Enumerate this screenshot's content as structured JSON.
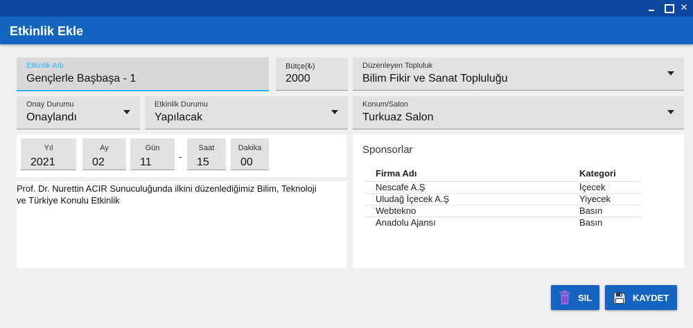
{
  "window": {
    "close_glyph": "✕"
  },
  "header": {
    "title": "Etkinlik Ekle"
  },
  "form": {
    "event_name": {
      "label": "Etkinlik Adı",
      "value": "Gençlerle Başbaşa - 1"
    },
    "budget": {
      "label": "Bütçe(₺)",
      "value": "2000"
    },
    "organizer": {
      "label": "Düzenleyen Topluluk",
      "value": "Bilim Fikir ve Sanat Topluluğu"
    },
    "approval": {
      "label": "Onay Durumu",
      "value": "Onaylandı"
    },
    "status": {
      "label": "Etkinlik Durumu",
      "value": "Yapılacak"
    },
    "location": {
      "label": "Konum/Salon",
      "value": "Turkuaz Salon"
    }
  },
  "date": {
    "year": {
      "label": "Yıl",
      "value": "2021"
    },
    "month": {
      "label": "Ay",
      "value": "02"
    },
    "day": {
      "label": "Gün",
      "value": "11"
    },
    "separator": "-",
    "hour": {
      "label": "Saat",
      "value": "15"
    },
    "minute": {
      "label": "Dakika",
      "value": "00"
    }
  },
  "description": {
    "line1": "Prof. Dr. Nurettin ACIR Sunuculuğunda ilkini düzenlediğimiz Bilim, Teknoloji",
    "line2": "ve Türkiye Konulu Etkinlik"
  },
  "sponsors": {
    "title": "Sponsorlar",
    "columns": [
      "Firma Adı",
      "Kategori"
    ],
    "rows": [
      {
        "firma": "Nescafe A.Ş",
        "kategori": "İçecek"
      },
      {
        "firma": "Uludağ İçecek A.Ş",
        "kategori": "Yiyecek"
      },
      {
        "firma": "Webtekno",
        "kategori": "Basın"
      },
      {
        "firma": "Anadolu Ajansı",
        "kategori": "Basın"
      }
    ]
  },
  "actions": {
    "delete_label": "SIL",
    "save_label": "KAYDET"
  },
  "colors": {
    "titlebar": "#0d47a1",
    "header": "#1565c0",
    "accent": "#29b6f6",
    "button": "#1565c0",
    "trash": "#8e6bd8"
  },
  "icons": {
    "delete": "trash-icon",
    "save": "floppy-disk-icon",
    "dropdown": "caret-down-icon"
  }
}
